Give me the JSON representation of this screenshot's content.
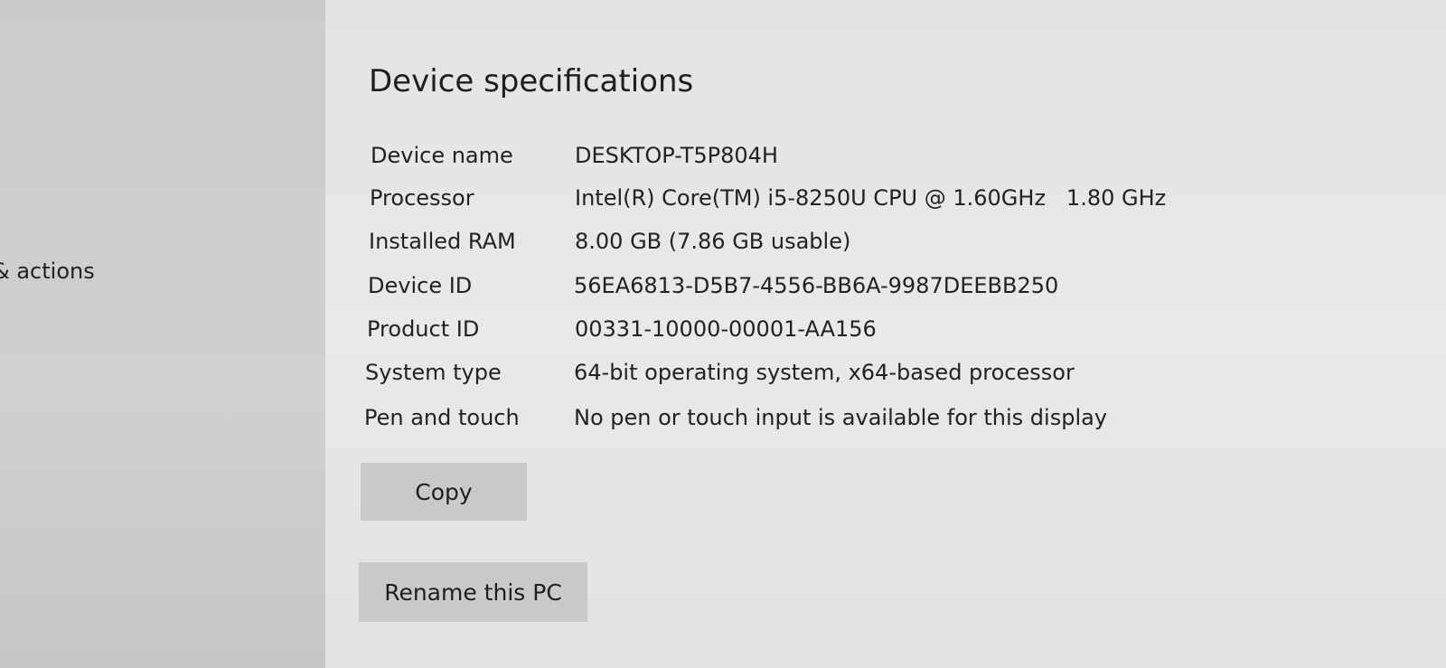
{
  "sidebar": {
    "partial_item": "& actions"
  },
  "section": {
    "title": "Device specifications",
    "specs": [
      {
        "label": "Device name",
        "value": "DESKTOP-T5P804H"
      },
      {
        "label": "Processor",
        "value": "Intel(R) Core(TM) i5-8250U CPU @ 1.60GHz   1.80 GHz"
      },
      {
        "label": "Installed RAM",
        "value": "8.00 GB (7.86 GB usable)"
      },
      {
        "label": "Device ID",
        "value": "56EA6813-D5B7-4556-BB6A-9987DEEBB250"
      },
      {
        "label": "Product ID",
        "value": "00331-10000-00001-AA156"
      },
      {
        "label": "System type",
        "value": "64-bit operating system, x64-based processor"
      },
      {
        "label": "Pen and touch",
        "value": "No pen or touch input is available for this display"
      }
    ],
    "copy_label": "Copy",
    "rename_label": "Rename this PC"
  }
}
